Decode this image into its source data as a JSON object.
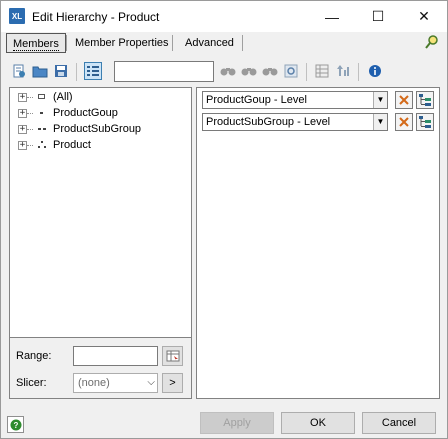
{
  "window": {
    "title": "Edit Hierarchy - Product",
    "app_icon_text": "XL",
    "minimize_glyph": "—",
    "maximize_glyph": "☐",
    "close_glyph": "✕"
  },
  "tabs": [
    {
      "label": "Members",
      "active": true
    },
    {
      "label": "Member Properties",
      "active": false
    },
    {
      "label": "Advanced",
      "active": false
    }
  ],
  "toolbar": {
    "search_value": "",
    "icons": [
      "new-icon",
      "open-folder-icon",
      "save-icon",
      "tree-view-icon",
      "binoculars-icon",
      "binoculars-next-icon",
      "binoculars-prev-icon",
      "find-icon",
      "grid-icon",
      "sort-icon",
      "info-icon"
    ]
  },
  "tree": {
    "items": [
      {
        "label": "(All)",
        "expander": "+"
      },
      {
        "label": "ProductGoup",
        "expander": "+"
      },
      {
        "label": "ProductSubGroup",
        "expander": "+"
      },
      {
        "label": "Product",
        "expander": "+"
      }
    ]
  },
  "range": {
    "label": "Range:",
    "value": ""
  },
  "slicer": {
    "label": "Slicer:",
    "value": "(none)",
    "go_label": ">"
  },
  "levels": [
    {
      "value": "ProductGoup - Level"
    },
    {
      "value": "ProductSubGroup - Level"
    }
  ],
  "buttons": {
    "apply": "Apply",
    "ok": "OK",
    "cancel": "Cancel"
  },
  "colors": {
    "accent": "#3c7fb1",
    "delete_x": "#d46a1a",
    "info": "#1f5fae",
    "help": "#2e8b2e"
  }
}
